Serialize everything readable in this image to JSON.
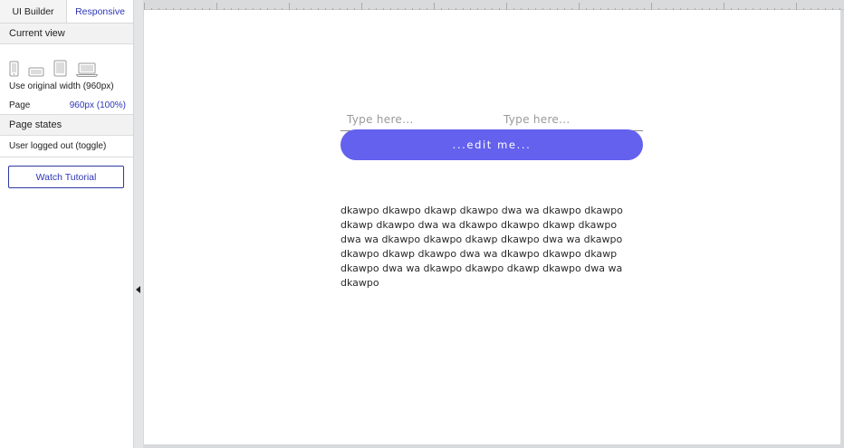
{
  "sidebar": {
    "tabs": [
      {
        "label": "UI Builder",
        "active": false
      },
      {
        "label": "Responsive",
        "active": true
      }
    ],
    "current_view": {
      "heading": "Current view",
      "devices": [
        "phone-icon",
        "phone-landscape-icon",
        "tablet-icon",
        "laptop-icon"
      ],
      "original_width_label": "Use original width (960px)",
      "page_label": "Page",
      "page_value": "960px (100%)"
    },
    "page_states": {
      "heading": "Page states",
      "items": [
        "User logged out (toggle)"
      ]
    },
    "tutorial_button": "Watch Tutorial"
  },
  "canvas": {
    "inputs": [
      {
        "placeholder": "Type here...",
        "value": ""
      },
      {
        "placeholder": "Type here...",
        "value": ""
      }
    ],
    "button_label": "...edit me...",
    "body_text": "dkawpo dkawpo dkawp dkawpo dwa wa dkawpo dkawpo dkawp dkawpo dwa wa dkawpo dkawpo dkawp dkawpo dwa wa dkawpo dkawpo dkawp dkawpo dwa wa dkawpo dkawpo dkawp dkawpo dwa wa dkawpo dkawpo dkawp dkawpo dwa wa dkawpo dkawpo dkawp dkawpo dwa wa dkawpo"
  },
  "colors": {
    "accent": "#2d36b8",
    "button": "#6461ee"
  }
}
